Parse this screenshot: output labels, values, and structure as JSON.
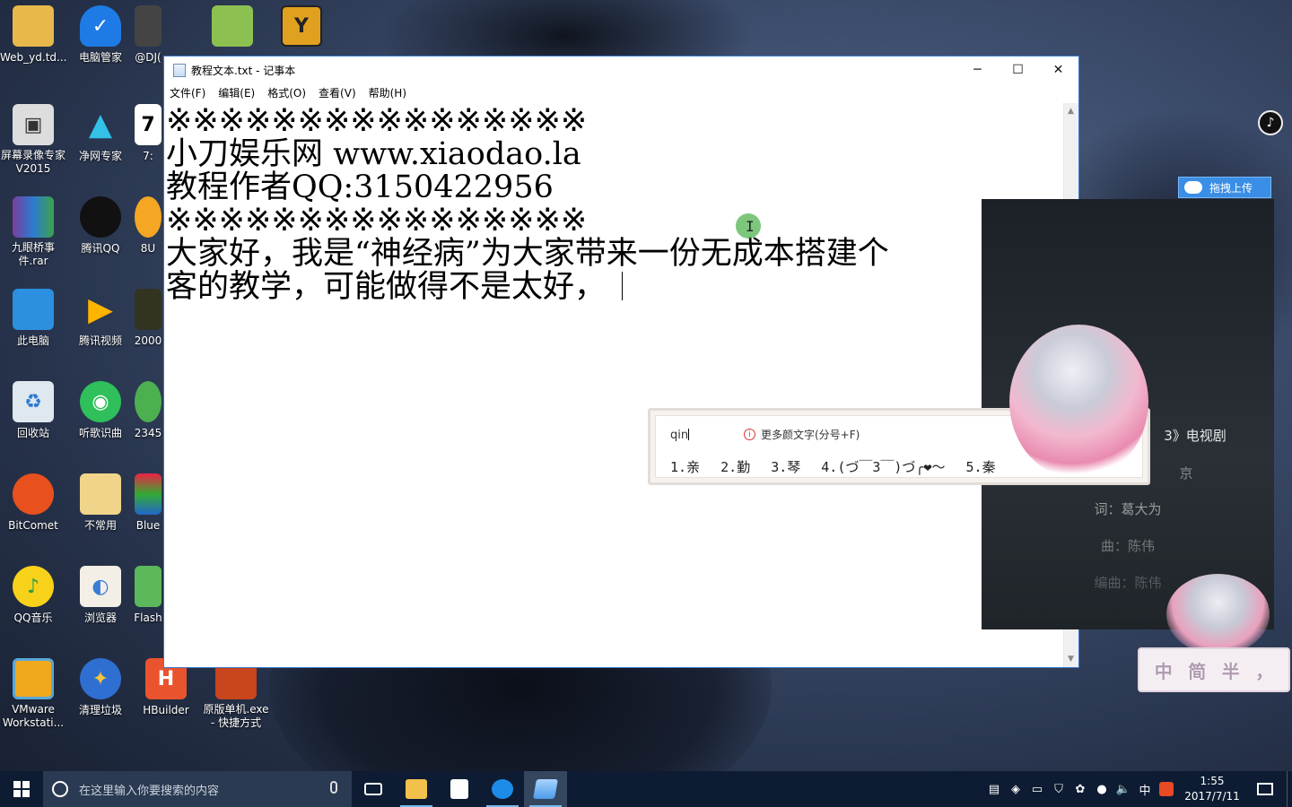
{
  "desktop": {
    "icons": [
      {
        "label": "Web_yd.td...",
        "icon": "folder-icon"
      },
      {
        "label": "电脑管家",
        "icon": "tencent-pc-manager-icon"
      },
      {
        "label": "@DJ(",
        "icon": "photo-icon"
      },
      {
        "label": "",
        "icon": "notepadpp-icon"
      },
      {
        "label": "",
        "icon": "installer-icon"
      },
      {
        "label": "屏幕录像专家V2015",
        "icon": "screen-recorder-icon"
      },
      {
        "label": "净网专家",
        "icon": "jingwang-icon"
      },
      {
        "label": "7:",
        "icon": "app-icon"
      },
      {
        "label": "九眼桥事件.rar",
        "icon": "winrar-icon"
      },
      {
        "label": "腾讯QQ",
        "icon": "qq-icon"
      },
      {
        "label": "8U",
        "icon": "app-icon"
      },
      {
        "label": "此电脑",
        "icon": "computer-icon"
      },
      {
        "label": "腾讯视频",
        "icon": "tencent-video-icon"
      },
      {
        "label": "2000",
        "icon": "game-icon"
      },
      {
        "label": "回收站",
        "icon": "recycle-bin-icon"
      },
      {
        "label": "听歌识曲",
        "icon": "music-recognition-icon"
      },
      {
        "label": "2345",
        "icon": "app-icon"
      },
      {
        "label": "BitComet",
        "icon": "bitcomet-icon"
      },
      {
        "label": "不常用",
        "icon": "folder-icon"
      },
      {
        "label": "Blue",
        "icon": "app-icon"
      },
      {
        "label": "QQ音乐",
        "icon": "qq-music-icon"
      },
      {
        "label": "浏览器",
        "icon": "browser-icon"
      },
      {
        "label": "Flash",
        "icon": "flash-icon"
      },
      {
        "label": "VMware Workstati...",
        "icon": "vmware-icon"
      },
      {
        "label": "清理垃圾",
        "icon": "cleaner-icon"
      },
      {
        "label": "HBuilder",
        "icon": "hbuilder-icon"
      },
      {
        "label": "原版单机.exe - 快捷方式",
        "icon": "game-shortcut-icon"
      }
    ]
  },
  "notepad": {
    "title": "教程文本.txt - 记事本",
    "menu": [
      "文件(F)",
      "编辑(E)",
      "格式(O)",
      "查看(V)",
      "帮助(H)"
    ],
    "lines": [
      "※※※※※※※※※※※※※※※※",
      "小刀娱乐网 www.xiaodao.la",
      "教程作者QQ:3150422956",
      "※※※※※※※※※※※※※※※※",
      "大家好，我是“神经病”为大家带来一份无成本搭建个",
      "客的教学，可能做得不是太好，"
    ]
  },
  "ime": {
    "composition": "qin",
    "more_hint": "更多颜文字(分号+F)",
    "candidates": [
      "1.亲",
      "2.勤",
      "3.琴",
      "4.(づ￣3￣)づ╭❤～",
      "5.秦"
    ]
  },
  "music_panel": {
    "upload_label": "拖拽上传",
    "lines": [
      "3》电视剧",
      "京",
      "词：葛大为",
      "曲：陈伟",
      "编曲：陈伟"
    ]
  },
  "sogou_bar": [
    "中",
    "简",
    "半",
    "，"
  ],
  "taskbar": {
    "search_placeholder": "在这里输入你要搜索的内容",
    "tray_ime": "中",
    "time": "1:55",
    "date": "2017/7/11"
  }
}
